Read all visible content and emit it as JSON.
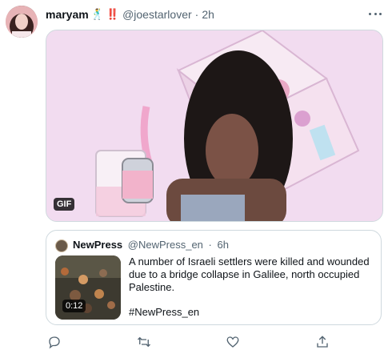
{
  "tweet": {
    "author_name": "maryam",
    "author_emojis": [
      "🕺",
      "‼️"
    ],
    "handle": "@joestarlover",
    "time": "2h",
    "media": {
      "badge": "GIF"
    }
  },
  "quote": {
    "author_name": "NewPress",
    "handle": "@NewPress_en",
    "time": "6h",
    "text": "A number of Israeli settlers were killed and wounded due to a bridge collapse in Galilee, north occupied Palestine.",
    "hashtag": "#NewPress_en",
    "video_duration": "0:12"
  },
  "icons": {
    "reply": "reply-icon",
    "retweet": "retweet-icon",
    "like": "like-icon",
    "share": "share-icon",
    "more": "more-icon"
  },
  "colors": {
    "secondary_text": "#536471",
    "border": "#cfd9de",
    "emoji_red": "#e0245e"
  }
}
